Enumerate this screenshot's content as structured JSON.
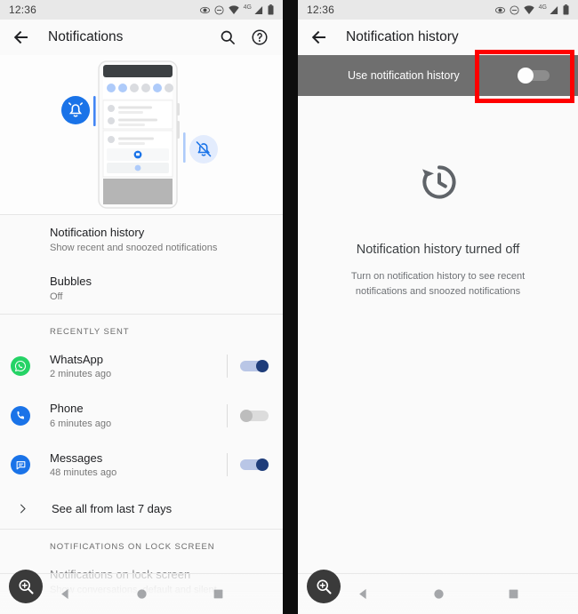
{
  "statusbar": {
    "time": "12:36",
    "icons": [
      "eye-icon",
      "do-not-disturb-icon",
      "wifi-icon",
      "signal-icon",
      "battery-icon"
    ],
    "network_label": "4G"
  },
  "left_phone": {
    "appbar": {
      "back_icon": "arrow-back-icon",
      "title": "Notifications",
      "search_icon": "search-icon",
      "help_icon": "help-circle-icon"
    },
    "illustration": {
      "name": "notifications-illustration",
      "bell_icon": "bell-icon",
      "bell_off_icon": "bell-off-icon"
    },
    "settings": [
      {
        "title": "Notification history",
        "subtitle": "Show recent and snoozed notifications"
      },
      {
        "title": "Bubbles",
        "subtitle": "Off"
      }
    ],
    "recently_sent": {
      "header": "RECENTLY SENT",
      "apps": [
        {
          "name": "WhatsApp",
          "time": "2 minutes ago",
          "icon": "whatsapp-icon",
          "color": "#25D366",
          "toggle": "on"
        },
        {
          "name": "Phone",
          "time": "6 minutes ago",
          "icon": "phone-icon",
          "color": "#1a73e8",
          "toggle": "off"
        },
        {
          "name": "Messages",
          "time": "48 minutes ago",
          "icon": "messages-icon",
          "color": "#1a73e8",
          "toggle": "on"
        }
      ],
      "see_all": "See all from last 7 days"
    },
    "lock_screen": {
      "header": "NOTIFICATIONS ON LOCK SCREEN",
      "title": "Notifications on lock screen",
      "subtitle": "Show conversations, default and silent"
    }
  },
  "right_phone": {
    "appbar": {
      "back_icon": "arrow-back-icon",
      "title": "Notification history"
    },
    "toggle_bar": {
      "label": "Use notification history",
      "state": "off"
    },
    "empty_state": {
      "icon": "history-clock-icon",
      "title": "Notification history turned off",
      "message": "Turn on notification history to see recent notifications and snoozed notifications"
    }
  },
  "navbar": {
    "back_icon": "nav-back-triangle-icon",
    "home_icon": "nav-home-circle-icon",
    "recents_icon": "nav-recents-square-icon"
  },
  "fab": {
    "icon": "zoom-in-magnifier-icon"
  },
  "annotation": {
    "highlight_color": "#ff0000",
    "target": "use-notification-history-toggle"
  }
}
